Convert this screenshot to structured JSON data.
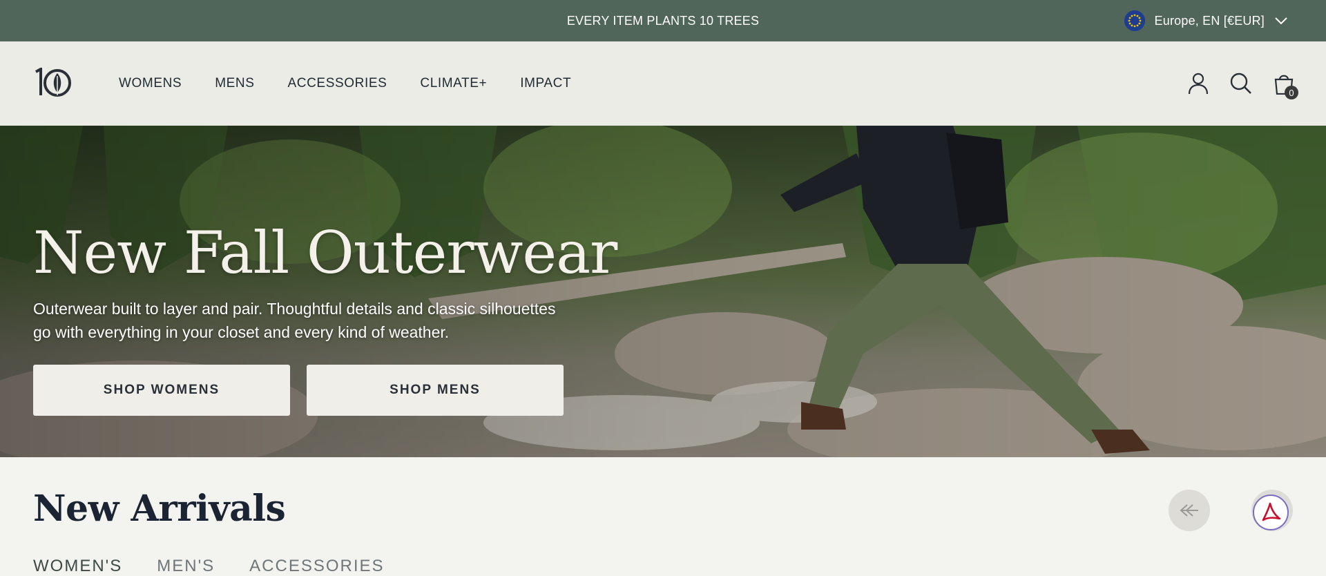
{
  "announcement": {
    "text": "EVERY ITEM PLANTS 10 TREES",
    "locale": "Europe, EN [€EUR]"
  },
  "header": {
    "logo_text": "10",
    "nav": [
      "WOMENS",
      "MENS",
      "ACCESSORIES",
      "CLIMATE+",
      "IMPACT"
    ],
    "cart_count": "0"
  },
  "hero": {
    "title": "New Fall Outerwear",
    "subtitle": "Outerwear built to layer and pair. Thoughtful details and classic silhouettes go with everything in your closet and every kind of weather.",
    "buttons": [
      "SHOP WOMENS",
      "SHOP MENS"
    ]
  },
  "arrivals": {
    "title": "New Arrivals",
    "tabs": [
      "WOMEN'S",
      "MEN'S",
      "ACCESSORIES"
    ]
  },
  "colors": {
    "announce_bg": "#51665a",
    "header_bg": "#ecece7",
    "page_bg": "#f3f3f0",
    "button_bg": "#efeee9"
  }
}
